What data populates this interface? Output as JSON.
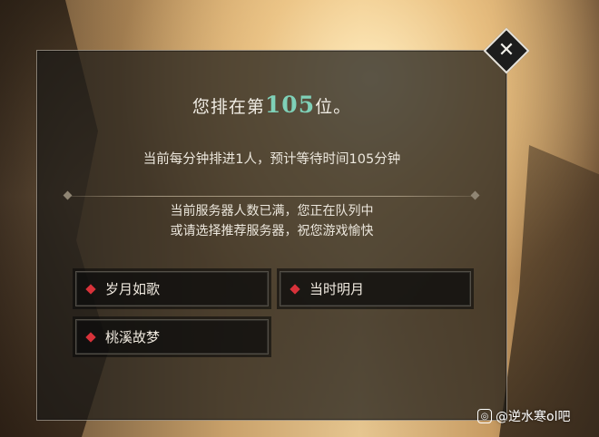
{
  "queue": {
    "rank_prefix": "您排在第",
    "rank_number": "105",
    "rank_suffix": "位。",
    "wait_text": "当前每分钟排进1人，预计等待时间105分钟",
    "message_line1": "当前服务器人数已满，您正在队列中",
    "message_line2": "或请选择推荐服务器，祝您游戏愉快"
  },
  "servers": [
    {
      "label": "岁月如歌"
    },
    {
      "label": "当时明月"
    },
    {
      "label": "桃溪故梦"
    }
  ],
  "close": {
    "glyph": "✕",
    "icon": "close-icon"
  },
  "watermark": {
    "text": "@逆水寒ol吧"
  },
  "colors": {
    "rank_number": "#7fd1b8",
    "server_marker": "#d8323a"
  }
}
